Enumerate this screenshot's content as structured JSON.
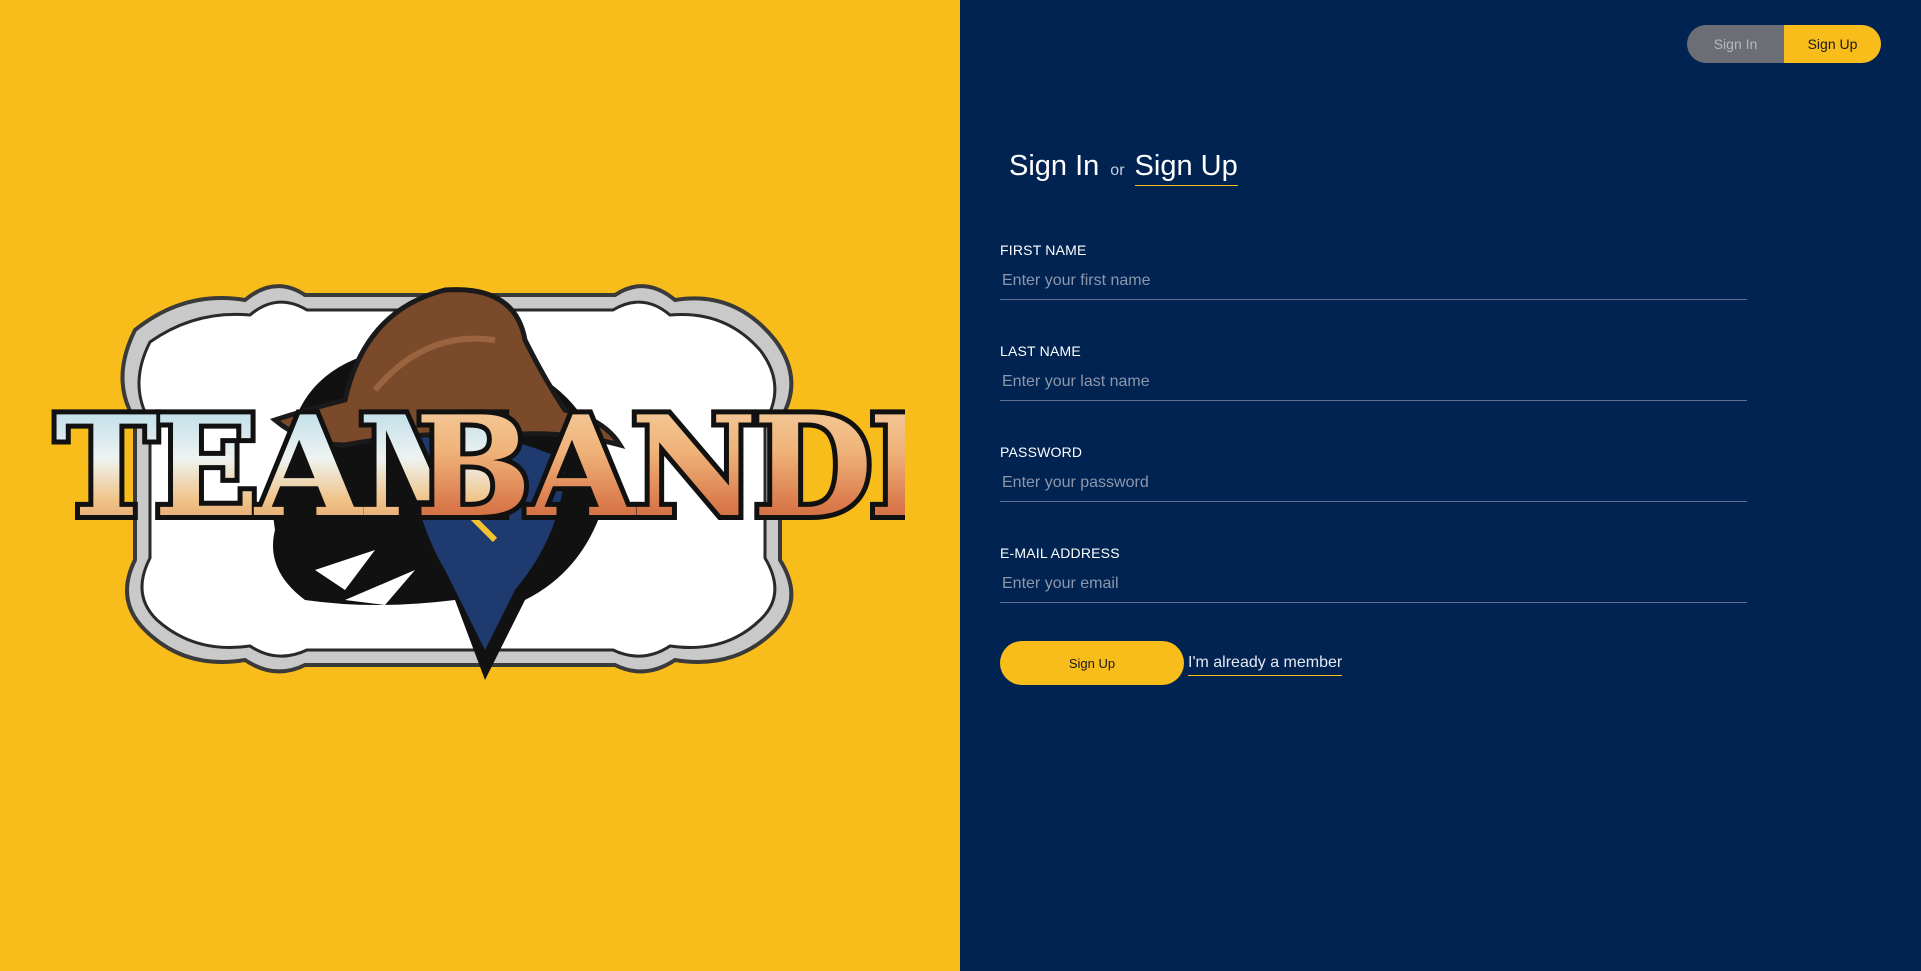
{
  "brand": {
    "wordmark_part1": "TEAM",
    "wordmark_part2": "BANDIT",
    "colors": {
      "gold": "#f8bd1a",
      "navy": "#012352",
      "hat_brown": "#7a4a2a",
      "bandana_blue": "#1e3a6e"
    }
  },
  "toggle": {
    "signin_label": "Sign In",
    "signup_label": "Sign Up",
    "active": "Sign Up"
  },
  "form_title": {
    "signin_label": "Sign In",
    "separator": "or",
    "signup_label": "Sign Up"
  },
  "fields": [
    {
      "label": "FIRST NAME",
      "placeholder": "Enter your first name",
      "value": ""
    },
    {
      "label": "LAST NAME",
      "placeholder": "Enter your last name",
      "value": ""
    },
    {
      "label": "PASSWORD",
      "placeholder": "Enter your password",
      "value": ""
    },
    {
      "label": "E-MAIL ADDRESS",
      "placeholder": "Enter your email",
      "value": ""
    }
  ],
  "actions": {
    "submit_label": "Sign Up",
    "member_link_label": "I'm already a member"
  }
}
